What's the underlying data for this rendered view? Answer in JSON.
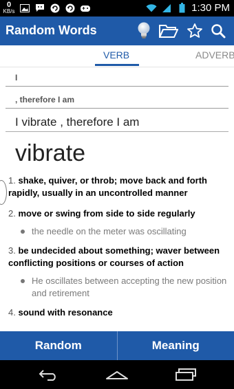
{
  "status_bar": {
    "speed_value": "0",
    "speed_unit": "KB/s",
    "time": "1:30",
    "ampm": "PM"
  },
  "app_bar": {
    "title": "Random Words",
    "icons": [
      "lightbulb-icon",
      "folder-icon",
      "star-icon",
      "search-icon"
    ]
  },
  "tabs": [
    {
      "label": "VERB",
      "active": true
    },
    {
      "label": "ADVERB",
      "active": false
    }
  ],
  "inputs": {
    "field1": "I",
    "field2": ", therefore I am",
    "combined": "I vibrate , therefore I am"
  },
  "word": "vibrate",
  "definitions": [
    {
      "num": "1.",
      "text": "shake, quiver, or throb; move back and forth rapidly, usually in an uncontrolled manner"
    },
    {
      "num": "2.",
      "text": "move or swing from side to side regularly",
      "example": "the needle on the meter was oscillating"
    },
    {
      "num": "3.",
      "text": "be undecided about something; waver between conflicting positions or courses of action",
      "example": "He oscillates between accepting the new position and retirement"
    },
    {
      "num": "4.",
      "text": "sound with resonance"
    }
  ],
  "buttons": {
    "random": "Random",
    "meaning": "Meaning"
  },
  "colors": {
    "primary": "#1f5aa8",
    "status_bar": "#000000"
  }
}
